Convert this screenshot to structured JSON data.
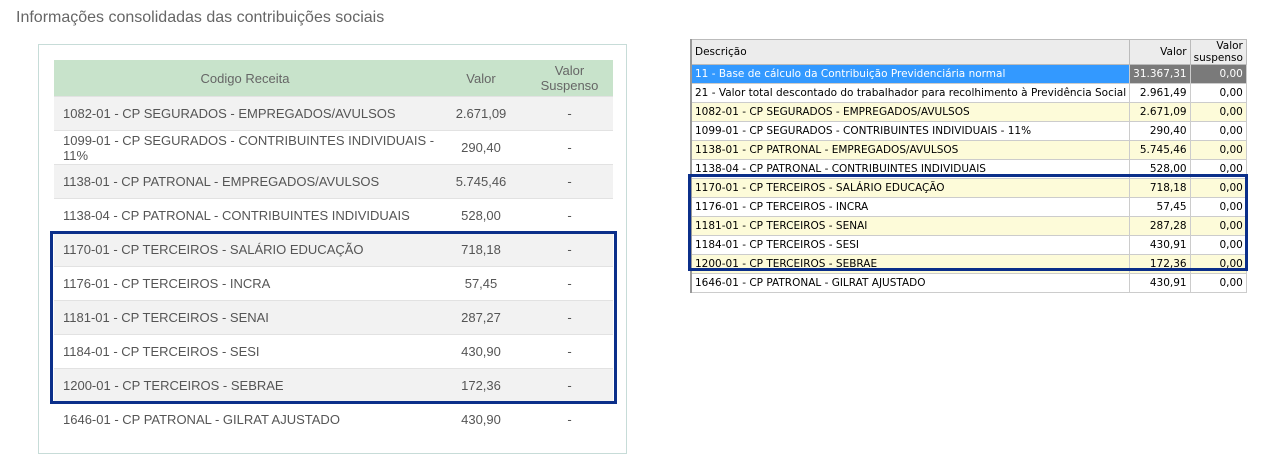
{
  "title": "Informações consolidadas das contribuições sociais",
  "left_table": {
    "headers": [
      "Codigo Receita",
      "Valor",
      "Valor Suspenso"
    ],
    "rows": [
      [
        "1082-01 - CP SEGURADOS - EMPREGADOS/AVULSOS",
        "2.671,09",
        "-"
      ],
      [
        "1099-01 - CP SEGURADOS - CONTRIBUINTES INDIVIDUAIS - 11%",
        "290,40",
        "-"
      ],
      [
        "1138-01 - CP PATRONAL - EMPREGADOS/AVULSOS",
        "5.745,46",
        "-"
      ],
      [
        "1138-04 - CP PATRONAL - CONTRIBUINTES INDIVIDUAIS",
        "528,00",
        "-"
      ],
      [
        "1170-01 - CP TERCEIROS - SALÁRIO EDUCAÇÃO",
        "718,18",
        "-"
      ],
      [
        "1176-01 - CP TERCEIROS - INCRA",
        "57,45",
        "-"
      ],
      [
        "1181-01 - CP TERCEIROS - SENAI",
        "287,27",
        "-"
      ],
      [
        "1184-01 - CP TERCEIROS - SESI",
        "430,90",
        "-"
      ],
      [
        "1200-01 - CP TERCEIROS - SEBRAE",
        "172,36",
        "-"
      ],
      [
        "1646-01 - CP PATRONAL - GILRAT AJUSTADO",
        "430,90",
        "-"
      ]
    ]
  },
  "right_table": {
    "headers": [
      "Descrição",
      "Valor",
      "Valor suspenso"
    ],
    "rows": [
      [
        "11 - Base de cálculo da Contribuição Previdenciária normal",
        "31.367,31",
        "0,00"
      ],
      [
        "21 - Valor total descontado do trabalhador para recolhimento à Previdência Social",
        "2.961,49",
        "0,00"
      ],
      [
        "1082-01 - CP SEGURADOS - EMPREGADOS/AVULSOS",
        "2.671,09",
        "0,00"
      ],
      [
        "1099-01 - CP SEGURADOS - CONTRIBUINTES INDIVIDUAIS - 11%",
        "290,40",
        "0,00"
      ],
      [
        "1138-01 - CP PATRONAL - EMPREGADOS/AVULSOS",
        "5.745,46",
        "0,00"
      ],
      [
        "1138-04 - CP PATRONAL - CONTRIBUINTES INDIVIDUAIS",
        "528,00",
        "0,00"
      ],
      [
        "1170-01 - CP TERCEIROS - SALÁRIO EDUCAÇÃO",
        "718,18",
        "0,00"
      ],
      [
        "1176-01 - CP TERCEIROS - INCRA",
        "57,45",
        "0,00"
      ],
      [
        "1181-01 - CP TERCEIROS - SENAI",
        "287,28",
        "0,00"
      ],
      [
        "1184-01 - CP TERCEIROS - SESI",
        "430,91",
        "0,00"
      ],
      [
        "1200-01 - CP TERCEIROS - SEBRAE",
        "172,36",
        "0,00"
      ],
      [
        "1646-01 - CP PATRONAL - GILRAT AJUSTADO",
        "430,91",
        "0,00"
      ]
    ]
  }
}
